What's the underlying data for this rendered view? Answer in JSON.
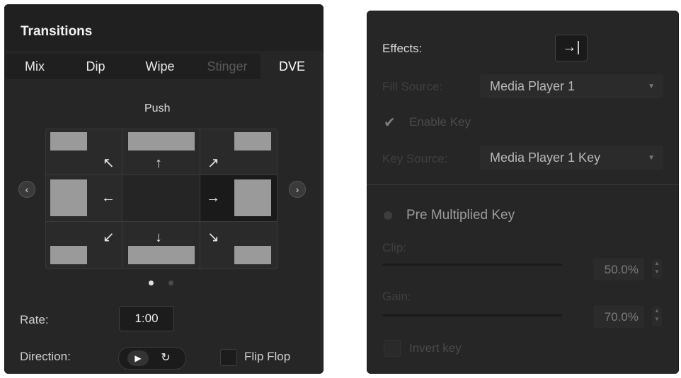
{
  "left": {
    "title": "Transitions",
    "tabs": [
      {
        "label": "Mix",
        "state": "normal"
      },
      {
        "label": "Dip",
        "state": "normal"
      },
      {
        "label": "Wipe",
        "state": "normal"
      },
      {
        "label": "Stinger",
        "state": "disabled"
      },
      {
        "label": "DVE",
        "state": "active"
      }
    ],
    "effect_name": "Push",
    "selected_direction": "right",
    "page_dots": {
      "count": 2,
      "active": 1
    },
    "rate_label": "Rate:",
    "rate_value": "1:00",
    "direction_label": "Direction:",
    "flip_flop_label": "Flip Flop",
    "flip_flop_checked": false
  },
  "right": {
    "effects_label": "Effects:",
    "fill_source_label": "Fill Source:",
    "fill_source_value": "Media Player 1",
    "enable_key_label": "Enable Key",
    "enable_key_checked": true,
    "key_source_label": "Key Source:",
    "key_source_value": "Media Player 1 Key",
    "pre_multiplied_label": "Pre Multiplied Key",
    "clip_label": "Clip:",
    "clip_value": "50.0%",
    "gain_label": "Gain:",
    "gain_value": "70.0%",
    "invert_key_label": "Invert key",
    "invert_key_checked": false
  },
  "colors": {
    "panel": "#262626",
    "header": "#202020",
    "accent_text": "#ffffff"
  }
}
